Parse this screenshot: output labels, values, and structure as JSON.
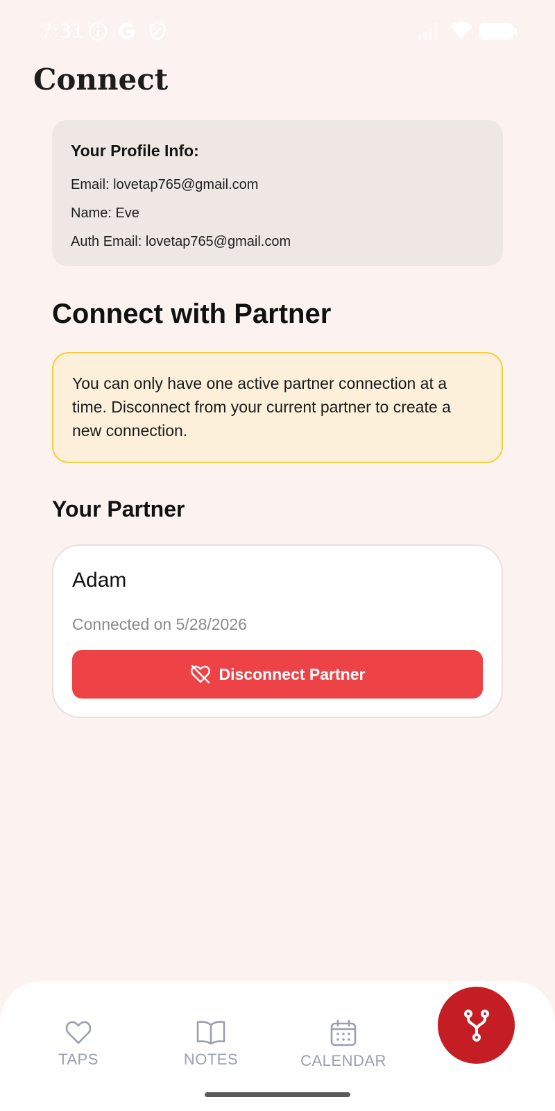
{
  "status_bar": {
    "time": "7:31",
    "icons": [
      "info-icon",
      "google-icon",
      "shield-icon",
      "signal-icon",
      "wifi-icon",
      "battery-icon"
    ]
  },
  "page": {
    "title": "Connect"
  },
  "profile": {
    "title": "Your Profile Info:",
    "email": "Email: lovetap765@gmail.com",
    "name": "Name: Eve",
    "auth_email": "Auth Email: lovetap765@gmail.com"
  },
  "connect": {
    "heading": "Connect with Partner",
    "notice": "You can only have one active partner connection at a time. Disconnect from your current partner to create a new connection."
  },
  "partner": {
    "heading": "Your Partner",
    "name": "Adam",
    "connected_on": "Connected on 5/28/2026",
    "disconnect_label": "Disconnect Partner"
  },
  "bottom_nav": {
    "items": [
      {
        "label": "TAPS",
        "icon": "heart-icon"
      },
      {
        "label": "NOTES",
        "icon": "book-icon"
      },
      {
        "label": "CALENDAR",
        "icon": "calendar-icon"
      }
    ],
    "active_icon": "fork-icon"
  },
  "colors": {
    "background": "#fcf3f0",
    "accent": "#c41e24",
    "disconnect": "#ee4346",
    "notice_bg": "#fcf0da",
    "notice_border": "#f2cf3d",
    "nav_inactive": "#9a9fae"
  }
}
